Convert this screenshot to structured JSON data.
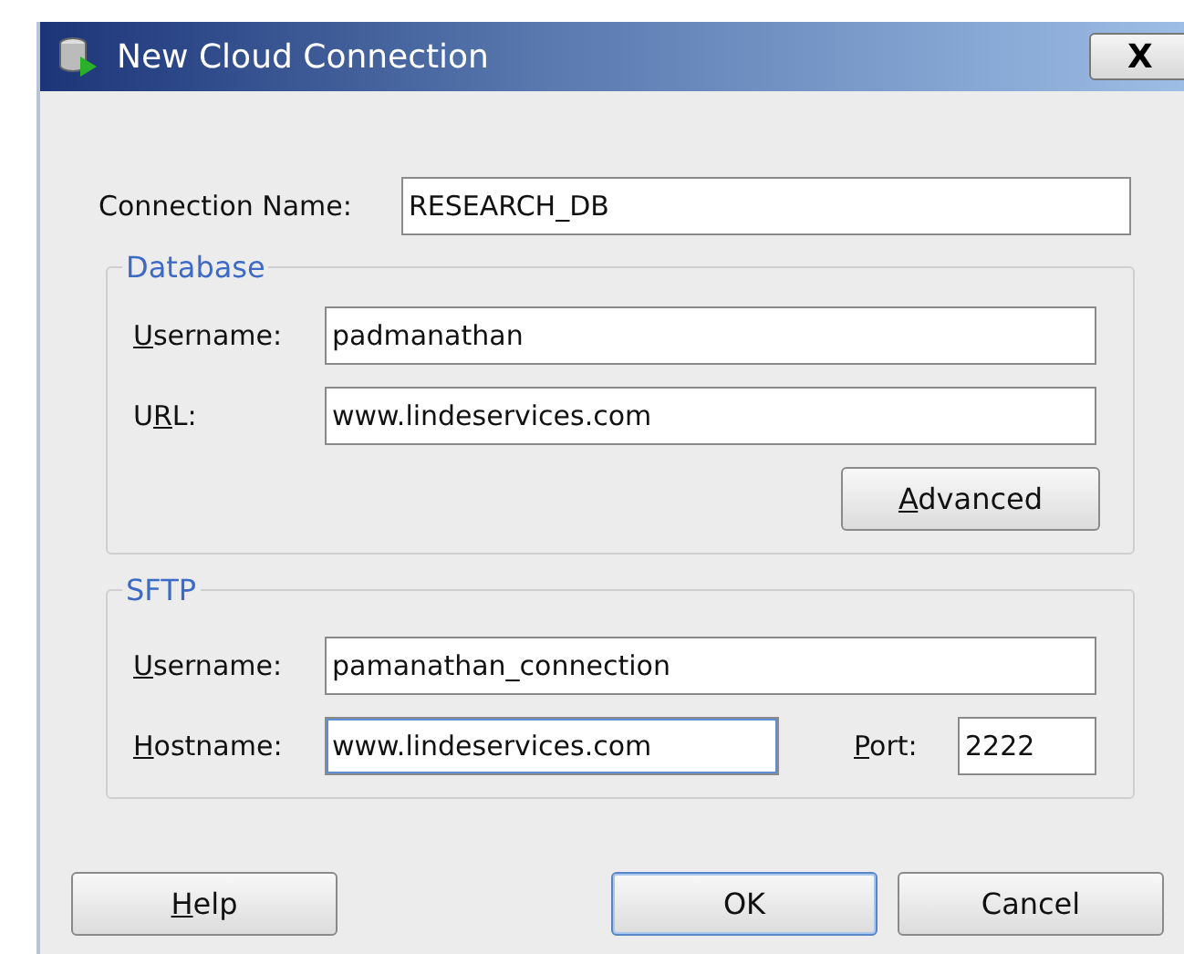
{
  "window": {
    "title": "New Cloud Connection",
    "close": "X"
  },
  "connection_name": {
    "label": {
      "before": "Connection Name:"
    },
    "value": "RESEARCH_DB"
  },
  "database": {
    "title": "Database",
    "fields": [
      {
        "label": {
          "key": "U",
          "after": "sername:"
        },
        "value": "padmanathan"
      },
      {
        "label": {
          "before": "U",
          "key": "R",
          "after": "L:"
        },
        "value": "www.lindeservices.com"
      }
    ],
    "advanced": {
      "label": {
        "key": "A",
        "after": "dvanced"
      }
    }
  },
  "sftp": {
    "title": "SFTP",
    "username": {
      "label": {
        "key": "U",
        "after": "sername:"
      },
      "value": "pamanathan_connection"
    },
    "hostname": {
      "label": {
        "key": "H",
        "after": "ostname:"
      },
      "value": "www.lindeservices.com",
      "focused": true
    },
    "port": {
      "label": {
        "key": "P",
        "after": "ort:"
      },
      "value": "2222"
    }
  },
  "buttons": [
    {
      "label": {
        "key": "H",
        "after": "elp"
      },
      "default": false
    },
    {
      "label": {
        "before": "OK"
      },
      "default": true
    },
    {
      "label": {
        "before": "Cancel"
      },
      "default": false
    }
  ]
}
